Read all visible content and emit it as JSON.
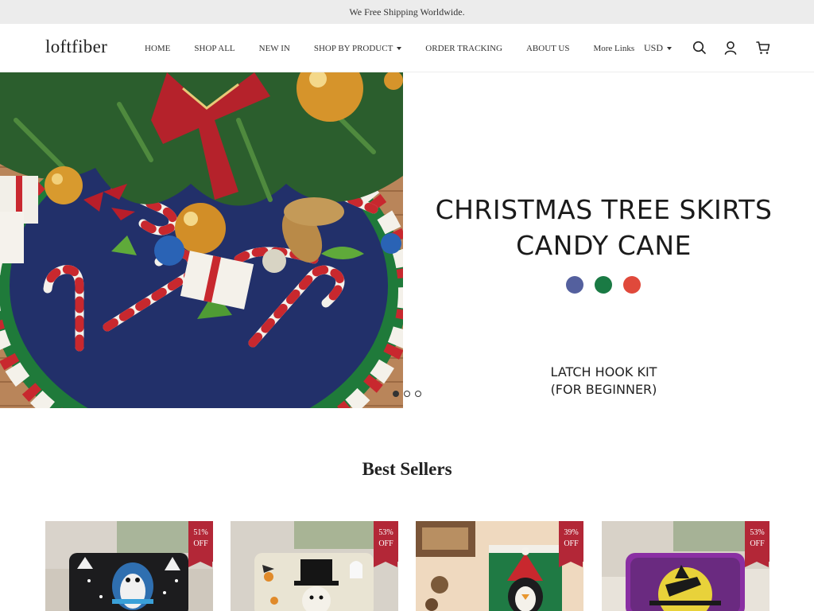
{
  "announcement": "We Free Shipping Worldwide.",
  "brand": "loftfiber",
  "nav": {
    "home": "HOME",
    "shop_all": "SHOP ALL",
    "new_in": "NEW IN",
    "shop_by_product": "SHOP BY PRODUCT",
    "order_tracking": "ORDER TRACKING",
    "about_us": "ABOUT US",
    "more_links": "More Links"
  },
  "currency": "USD",
  "icons": [
    "search-icon",
    "account-icon",
    "cart-icon",
    "chevron-down-icon"
  ],
  "hero": {
    "title_line1": "CHRISTMAS TREE SKIRTS",
    "title_line2": "CANDY CANE",
    "subtitle_line1": "LATCH HOOK KIT",
    "subtitle_line2": "(FOR BEGINNER)",
    "swatches": [
      "#54609e",
      "#1a7a44",
      "#e0493b"
    ],
    "slide_count": 3,
    "active_slide": 1
  },
  "best_sellers": {
    "title": "Best Sellers",
    "products": [
      {
        "discount": "51%",
        "off": "OFF"
      },
      {
        "discount": "53%",
        "off": "OFF"
      },
      {
        "discount": "39%",
        "off": "OFF"
      },
      {
        "discount": "53%",
        "off": "OFF"
      }
    ]
  },
  "colors": {
    "badge": "#b32737",
    "announcement_bg": "#ececec",
    "skirt_navy": "#22306a"
  }
}
